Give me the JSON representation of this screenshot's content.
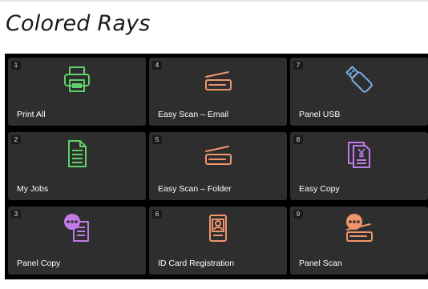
{
  "header": {
    "title": "Colored Rays"
  },
  "tiles": [
    {
      "number": "1",
      "label": "Print All",
      "icon": "printer-icon",
      "color": "#5fd16a"
    },
    {
      "number": "2",
      "label": "My Jobs",
      "icon": "document-icon",
      "color": "#5fd16a"
    },
    {
      "number": "3",
      "label": "Panel Copy",
      "icon": "copy-more-icon",
      "color": "#c07be6"
    },
    {
      "number": "4",
      "label": "Easy Scan – Email",
      "icon": "scanner-icon",
      "color": "#f0956b"
    },
    {
      "number": "5",
      "label": "Easy Scan – Folder",
      "icon": "scanner-icon",
      "color": "#f0956b"
    },
    {
      "number": "6",
      "label": "ID Card Registration",
      "icon": "id-card-icon",
      "color": "#f0956b"
    },
    {
      "number": "7",
      "label": "Panel USB",
      "icon": "usb-drive-icon",
      "color": "#7aaee8"
    },
    {
      "number": "8",
      "label": "Easy Copy",
      "icon": "copy-yen-icon",
      "color": "#c07be6"
    },
    {
      "number": "9",
      "label": "Panel Scan",
      "icon": "scanner-more-icon",
      "color": "#f0956b"
    }
  ]
}
